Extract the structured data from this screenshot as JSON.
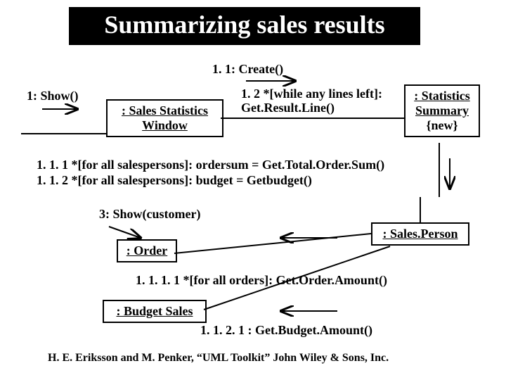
{
  "title": "Summarizing sales results",
  "messages": {
    "create": "1. 1: Create()",
    "show": "1: Show()",
    "resultline_a": "1. 2 *[while any lines left]:",
    "resultline_b": "Get.Result.Line()",
    "ordersum": "1. 1. 1 *[for all salespersons]: ordersum = Get.Total.Order.Sum()",
    "budget": "1. 1. 2 *[for all salespersons]: budget = Getbudget()",
    "showcust": "3: Show(customer)",
    "orderamt": "1. 1. 1. 1 *[for all orders]: Get.Order.Amount()",
    "budgetamt": "1. 1. 2. 1 : Get.Budget.Amount()"
  },
  "objects": {
    "stats_a": ": Sales Statistics",
    "stats_b": "Window",
    "summary_a": ": Statistics",
    "summary_b": "Summary",
    "summary_tag": "{new}",
    "salesperson": ": Sales.Person",
    "order": ": Order",
    "budgetsales": ": Budget Sales"
  },
  "footer": "H. E. Eriksson and M. Penker, “UML Toolkit” John Wiley & Sons, Inc.",
  "chart_data": {
    "type": "diagram",
    "diagram_type": "UML collaboration diagram",
    "title": "Summarizing sales results",
    "objects": [
      {
        "id": "stats_window",
        "label": ": Sales Statistics Window",
        "new": false
      },
      {
        "id": "stats_summary",
        "label": ": Statistics Summary",
        "new": true
      },
      {
        "id": "sales_person",
        "label": ": Sales.Person",
        "new": false
      },
      {
        "id": "order",
        "label": ": Order",
        "new": false
      },
      {
        "id": "budget_sales",
        "label": ": Budget Sales",
        "new": false
      }
    ],
    "messages": [
      {
        "seq": "1",
        "text": "Show()",
        "from": "external",
        "to": "stats_window"
      },
      {
        "seq": "1.1",
        "text": "Create()",
        "from": "stats_window",
        "to": "stats_summary"
      },
      {
        "seq": "1.2",
        "guard": "*[while any lines left]",
        "text": "Get.Result.Line()",
        "from": "stats_window",
        "to": "stats_summary"
      },
      {
        "seq": "1.1.1",
        "guard": "*[for all salespersons]",
        "text": "ordersum = Get.Total.Order.Sum()",
        "from": "stats_summary",
        "to": "sales_person"
      },
      {
        "seq": "1.1.2",
        "guard": "*[for all salespersons]",
        "text": "budget = Getbudget()",
        "from": "stats_summary",
        "to": "sales_person"
      },
      {
        "seq": "3",
        "text": "Show(customer)",
        "from": "external",
        "to": "order"
      },
      {
        "seq": "1.1.1.1",
        "guard": "*[for all orders]",
        "text": "Get.Order.Amount()",
        "from": "sales_person",
        "to": "order"
      },
      {
        "seq": "1.1.2.1",
        "text": "Get.Budget.Amount()",
        "from": "sales_person",
        "to": "budget_sales"
      }
    ],
    "source": "H. E. Eriksson and M. Penker, “UML Toolkit” John Wiley & Sons, Inc."
  }
}
